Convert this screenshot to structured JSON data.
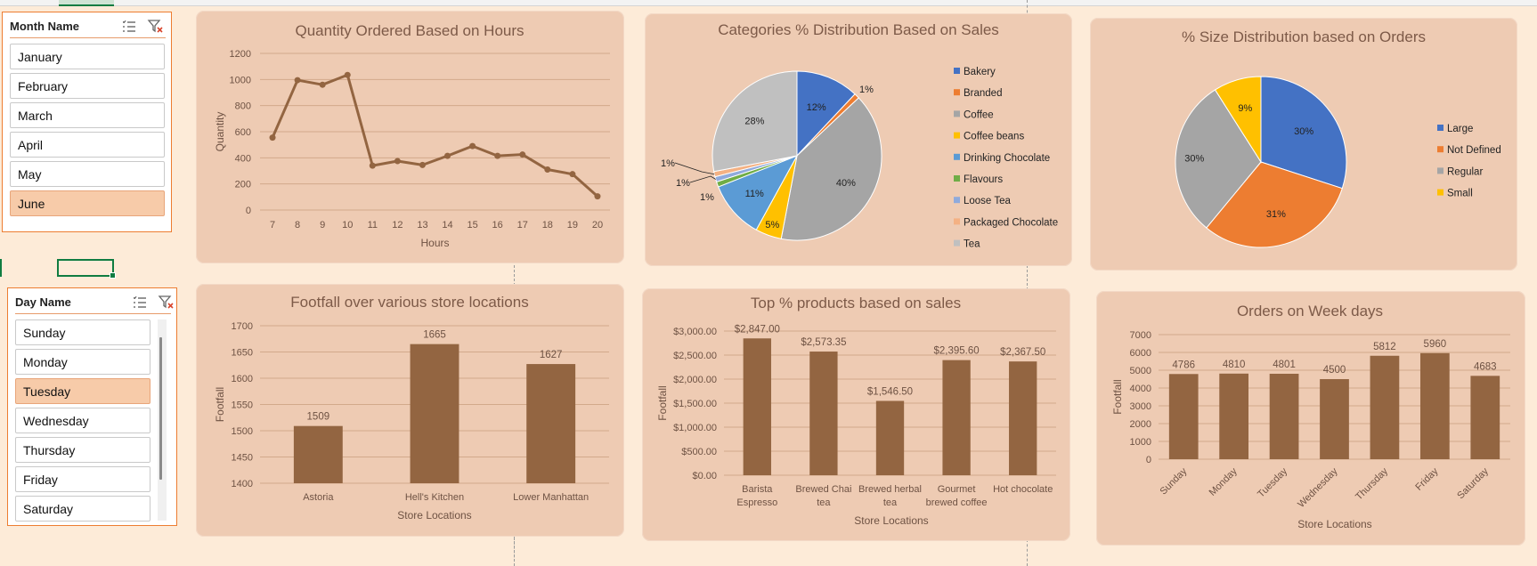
{
  "slicers": {
    "month": {
      "title": "Month Name",
      "items": [
        {
          "label": "January",
          "selected": false
        },
        {
          "label": "February",
          "selected": false
        },
        {
          "label": "March",
          "selected": false
        },
        {
          "label": "April",
          "selected": false
        },
        {
          "label": "May",
          "selected": false
        },
        {
          "label": "June",
          "selected": true
        }
      ]
    },
    "day": {
      "title": "Day Name",
      "items": [
        {
          "label": "Sunday",
          "selected": false
        },
        {
          "label": "Monday",
          "selected": false
        },
        {
          "label": "Tuesday",
          "selected": true
        },
        {
          "label": "Wednesday",
          "selected": false
        },
        {
          "label": "Thursday",
          "selected": false
        },
        {
          "label": "Friday",
          "selected": false
        },
        {
          "label": "Saturday",
          "selected": false
        }
      ]
    }
  },
  "colors": {
    "bar": "#936541",
    "line": "#936541",
    "panel": "#eecbb3",
    "text": "#7d5a48",
    "slicer_selected": "#f7cba9",
    "slicer_border": "#ed7d31"
  },
  "chart_data": [
    {
      "id": "hours",
      "type": "line",
      "title": "Quantity Ordered Based on Hours",
      "xlabel": "Hours",
      "ylabel": "Quantity",
      "x": [
        7,
        8,
        9,
        10,
        11,
        12,
        13,
        14,
        15,
        16,
        17,
        18,
        19,
        20
      ],
      "values": [
        555,
        995,
        960,
        1035,
        340,
        375,
        345,
        415,
        490,
        415,
        425,
        310,
        275,
        105
      ],
      "ylim": [
        0,
        1200
      ],
      "yticks": [
        0,
        200,
        400,
        600,
        800,
        1000,
        1200
      ],
      "grid": true
    },
    {
      "id": "categories",
      "type": "pie",
      "title": "Categories % Distribution Based on Sales",
      "legend_position": "right",
      "slices": [
        {
          "name": "Bakery",
          "value": 12,
          "label": "12%",
          "color": "#4472c4"
        },
        {
          "name": "Branded",
          "value": 1,
          "label": "1%",
          "color": "#ed7d31"
        },
        {
          "name": "Coffee",
          "value": 40,
          "label": "40%",
          "color": "#a5a5a5"
        },
        {
          "name": "Coffee beans",
          "value": 5,
          "label": "5%",
          "color": "#ffc000"
        },
        {
          "name": "Drinking Chocolate",
          "value": 11,
          "label": "11%",
          "color": "#5b9bd5"
        },
        {
          "name": "Flavours",
          "value": 1,
          "label": "1%",
          "color": "#70ad47"
        },
        {
          "name": "Loose Tea",
          "value": 1,
          "label": "1%",
          "color": "#8faadc"
        },
        {
          "name": "Packaged Chocolate",
          "value": 1,
          "label": "1%",
          "color": "#f4b183"
        },
        {
          "name": "Tea",
          "value": 28,
          "label": "28%",
          "color": "#c0c0c0"
        }
      ]
    },
    {
      "id": "size",
      "type": "pie",
      "title": "% Size Distribution based on Orders",
      "legend_position": "right",
      "slices": [
        {
          "name": "Large",
          "value": 30,
          "label": "30%",
          "color": "#4472c4"
        },
        {
          "name": "Not Defined",
          "value": 31,
          "label": "31%",
          "color": "#ed7d31"
        },
        {
          "name": "Regular",
          "value": 30,
          "label": "30%",
          "color": "#a5a5a5"
        },
        {
          "name": "Small",
          "value": 9,
          "label": "9%",
          "color": "#ffc000"
        }
      ]
    },
    {
      "id": "footfall",
      "type": "bar",
      "title": "Footfall over various store locations",
      "xlabel": "Store Locations",
      "ylabel": "Footfall",
      "categories": [
        "Astoria",
        "Hell's Kitchen",
        "Lower Manhattan"
      ],
      "values": [
        1509,
        1665,
        1627
      ],
      "value_labels": [
        "1509",
        "1665",
        "1627"
      ],
      "ylim": [
        1400,
        1700
      ],
      "yticks": [
        1400,
        1450,
        1500,
        1550,
        1600,
        1650,
        1700
      ]
    },
    {
      "id": "products",
      "type": "bar",
      "title": "Top % products based on sales",
      "xlabel": "Store Locations",
      "ylabel": "Footfall",
      "categories": [
        "Barista Espresso",
        "Brewed Chai tea",
        "Brewed herbal tea",
        "Gourmet brewed coffee",
        "Hot chocolate"
      ],
      "category_lines": [
        [
          "Barista",
          "Espresso"
        ],
        [
          "Brewed Chai",
          "tea"
        ],
        [
          "Brewed herbal",
          "tea"
        ],
        [
          "Gourmet",
          "brewed coffee"
        ],
        [
          "Hot chocolate"
        ]
      ],
      "values": [
        2847.0,
        2573.35,
        1546.5,
        2395.6,
        2367.5
      ],
      "value_labels": [
        "$2,847.00",
        "$2,573.35",
        "$1,546.50",
        "$2,395.60",
        "$2,367.50"
      ],
      "ylim": [
        0,
        3000
      ],
      "yticks": [
        0,
        500,
        1000,
        1500,
        2000,
        2500,
        3000
      ],
      "ytick_labels": [
        "$0.00",
        "$500.00",
        "$1,000.00",
        "$1,500.00",
        "$2,000.00",
        "$2,500.00",
        "$3,000.00"
      ]
    },
    {
      "id": "weekdays",
      "type": "bar",
      "title": "Orders on Week days",
      "xlabel": "Store Locations",
      "ylabel": "Footfall",
      "categories": [
        "Sunday",
        "Monday",
        "Tuesday",
        "Wednesday",
        "Thursday",
        "Friday",
        "Saturday"
      ],
      "values": [
        4786,
        4810,
        4801,
        4500,
        5812,
        5960,
        4683
      ],
      "value_labels": [
        "4786",
        "4810",
        "4801",
        "4500",
        "5812",
        "5960",
        "4683"
      ],
      "ylim": [
        0,
        7000
      ],
      "yticks": [
        0,
        1000,
        2000,
        3000,
        4000,
        5000,
        6000,
        7000
      ]
    }
  ]
}
